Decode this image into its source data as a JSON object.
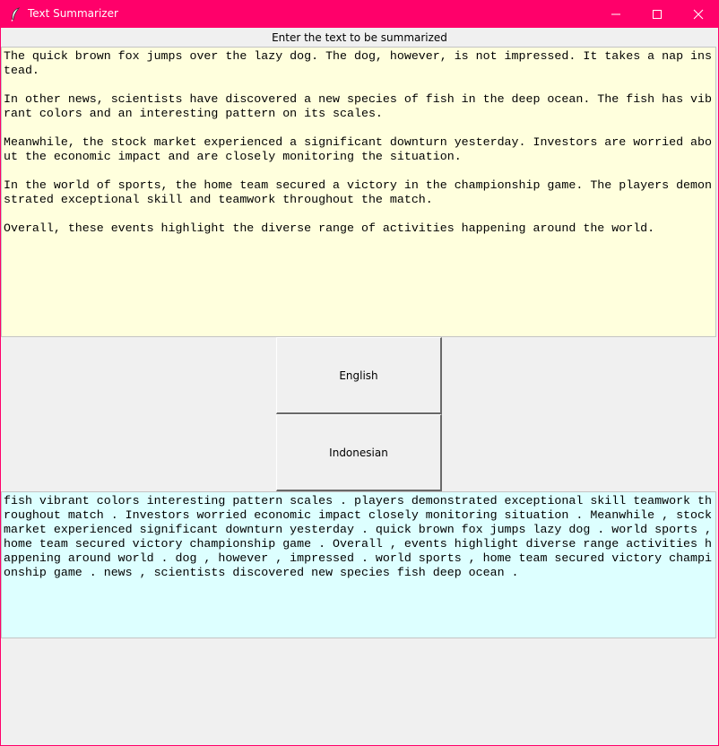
{
  "window": {
    "title": "Text Summarizer",
    "controls": {
      "minimize": "minimize",
      "maximize": "maximize",
      "close": "close"
    },
    "accent_color": "#ff006a"
  },
  "prompt": {
    "label": "Enter the text to be summarized"
  },
  "input": {
    "value": "The quick brown fox jumps over the lazy dog. The dog, however, is not impressed. It takes a nap instead.\n\nIn other news, scientists have discovered a new species of fish in the deep ocean. The fish has vibrant colors and an interesting pattern on its scales.\n\nMeanwhile, the stock market experienced a significant downturn yesterday. Investors are worried about the economic impact and are closely monitoring the situation.\n\nIn the world of sports, the home team secured a victory in the championship game. The players demonstrated exceptional skill and teamwork throughout the match.\n\nOverall, these events highlight the diverse range of activities happening around the world.",
    "background": "#ffffdd"
  },
  "buttons": {
    "english": "English",
    "indonesian": "Indonesian"
  },
  "output": {
    "value": "fish vibrant colors interesting pattern scales . players demonstrated exceptional skill teamwork throughout match . Investors worried economic impact closely monitoring situation . Meanwhile , stock market experienced significant downturn yesterday . quick brown fox jumps lazy dog . world sports , home team secured victory championship game . Overall , events highlight diverse range activities happening around world . dog , however , impressed . world sports , home team secured victory championship game . news , scientists discovered new species fish deep ocean .",
    "background": "#ddffff"
  }
}
